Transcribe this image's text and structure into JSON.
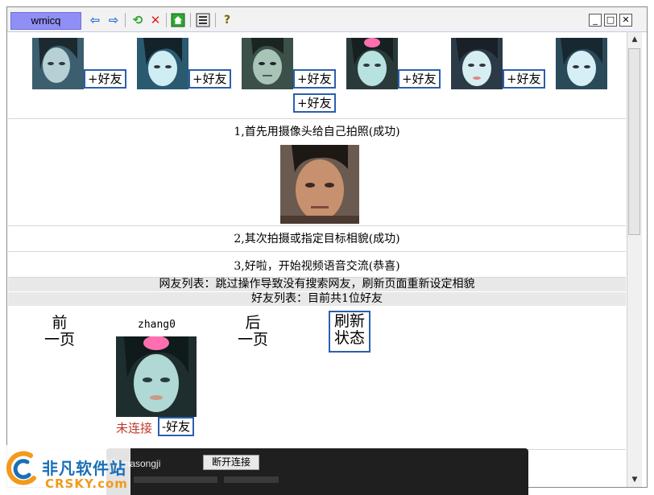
{
  "window": {
    "app_name": "wmicq"
  },
  "toolbar": {
    "icons": [
      "back-arrow-icon",
      "forward-arrow-icon",
      "refresh-icon",
      "stop-icon",
      "home-icon",
      "list-icon",
      "help-icon"
    ],
    "glyphs": {
      "back": "⇦",
      "forward": "⇨",
      "refresh": "⟲",
      "stop": "✕",
      "help": "?"
    }
  },
  "window_controls": {
    "minimize": "_",
    "maximize": "□",
    "close": "✕"
  },
  "search_results": {
    "add_label": "+好友"
  },
  "steps": {
    "step1": "1,首先用摄像头给自己拍照(成功)",
    "step2": "2,其次拍摄或指定目标相貌(成功)",
    "step3": "3,好啦，开始视频语音交流(恭喜)"
  },
  "netfriend_list": "网友列表：跳过操作导致没有搜索网友，刷新页面重新设定相貌",
  "friend_list": "好友列表：目前共1位好友",
  "nav": {
    "prev_line1": "前",
    "prev_line2": "一页",
    "next_line1": "后",
    "next_line1b": "一页",
    "refresh_line1": "刷新",
    "refresh_line2": "状态"
  },
  "friend": {
    "name": "zhang0",
    "status": "未连接",
    "remove_label": "-好友"
  },
  "popup": {
    "text": "连接为 masongji",
    "disconnect_label": "断开连接"
  },
  "watermark": {
    "cn": "非凡软件站",
    "en": "CRSKY.com"
  },
  "colors": {
    "app_tab": "#8f8ff5",
    "button_border": "#2a5fae",
    "offline_text": "#c0392b"
  }
}
